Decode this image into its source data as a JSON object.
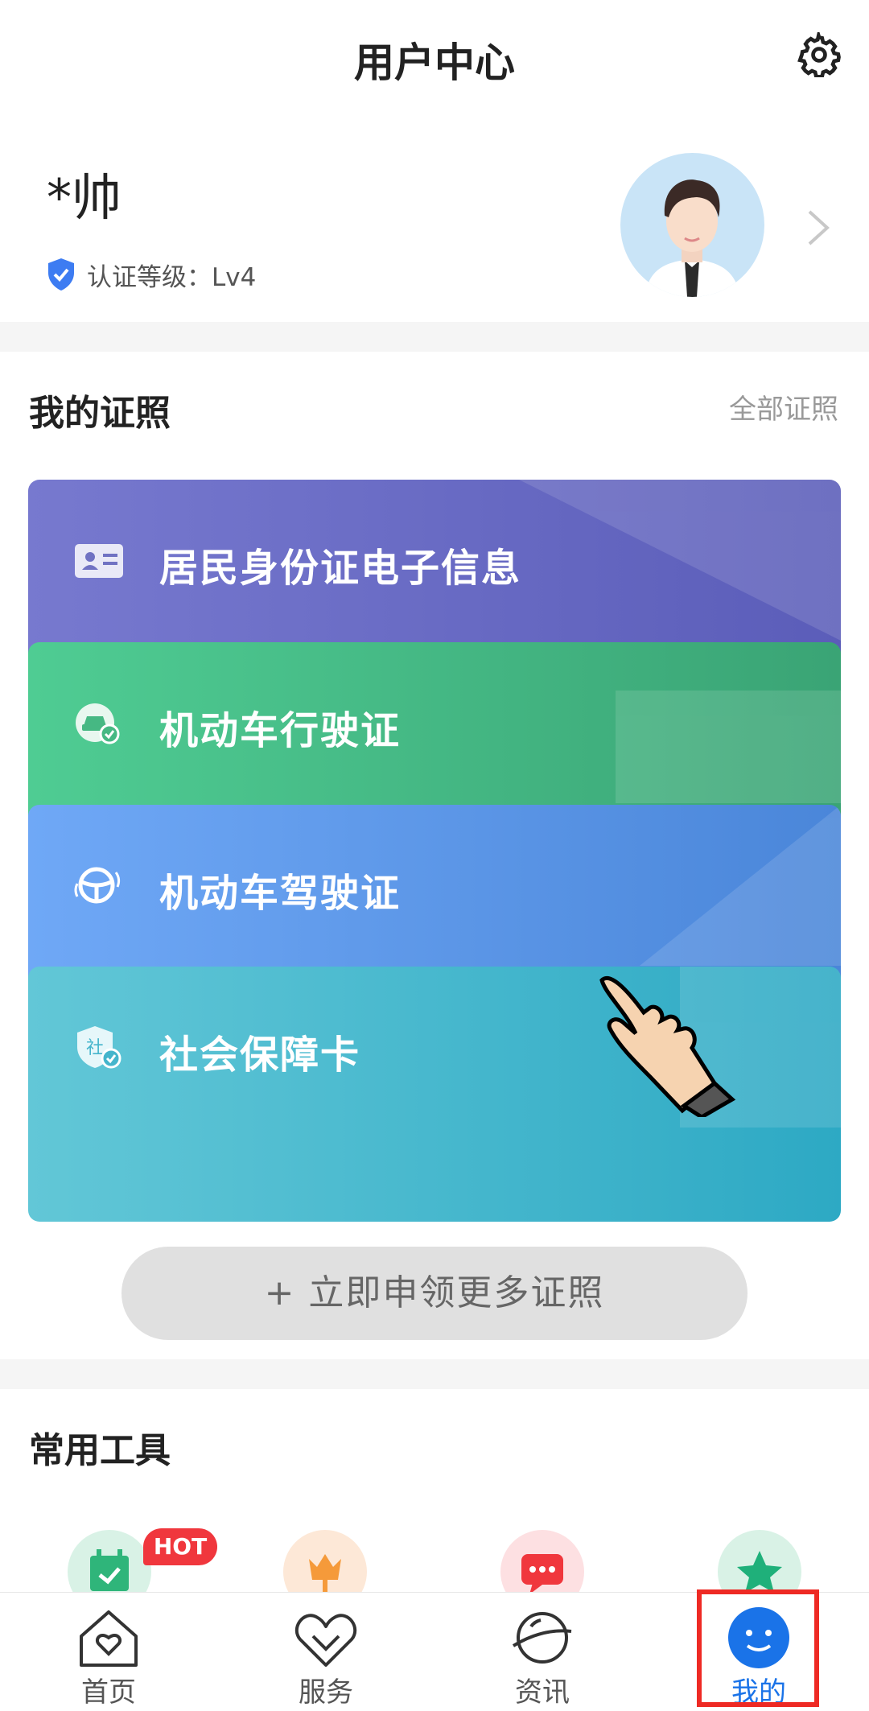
{
  "header": {
    "title": "用户中心",
    "settings_icon": "gear-icon"
  },
  "profile": {
    "username": "*帅",
    "cert_level_label": "认证等级：Lv4",
    "avatar_icon": "avatar-man-icon",
    "chevron_icon": "chevron-right-icon"
  },
  "licenses": {
    "title": "我的证照",
    "all_link": "全部证照",
    "cards": [
      {
        "name": "居民身份证电子信息",
        "icon": "id-card-icon",
        "color": "#6a6cc6"
      },
      {
        "name": "机动车行驶证",
        "icon": "car-check-icon",
        "color": "#45b984"
      },
      {
        "name": "机动车驾驶证",
        "icon": "steering-wheel-icon",
        "color": "#5c97e8"
      },
      {
        "name": "社会保障卡",
        "icon": "social-shield-icon",
        "color": "#44b6cd"
      }
    ],
    "apply_button": "+ 立即申领更多证照"
  },
  "tools": {
    "title": "常用工具",
    "hot_badge": "HOT"
  },
  "bottom_nav": [
    {
      "label": "首页",
      "icon": "home-heart-icon"
    },
    {
      "label": "服务",
      "icon": "heart-service-icon"
    },
    {
      "label": "资讯",
      "icon": "planet-icon"
    },
    {
      "label": "我的",
      "icon": "smiley-icon",
      "active": true
    }
  ],
  "colors": {
    "accent": "#1a73e8",
    "highlight": "#ee2a24",
    "hot": "#f0373d"
  }
}
